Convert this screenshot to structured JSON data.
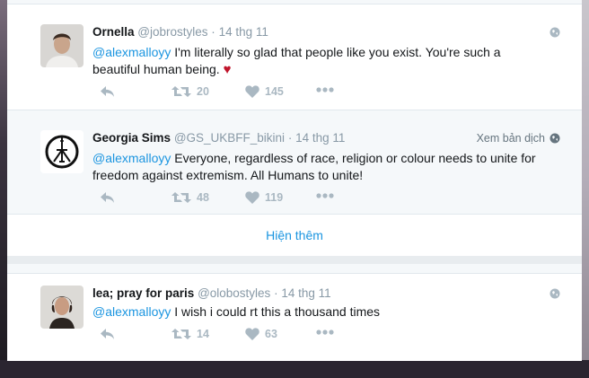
{
  "tweets": [
    {
      "name": "Ornella",
      "handle": "@jobrostyles",
      "sep": "·",
      "time": "14 thg 11",
      "mention": "@alexmalloyy",
      "text": " I'm literally so glad that people like you exist. You're such a beautiful human being. ",
      "emoji": "♥",
      "translate": "",
      "retweets": "20",
      "likes": "145"
    },
    {
      "name": "Georgia Sims",
      "handle": "@GS_UKBFF_bikini",
      "sep": "·",
      "time": "14 thg 11",
      "mention": "@alexmalloyy",
      "text": " Everyone, regardless of race, religion or colour needs to unite for freedom against extremism. All Humans to unite!",
      "translate": "Xem bản dịch",
      "retweets": "48",
      "likes": "119"
    },
    {
      "name": "lea; pray for paris",
      "handle": "@olobostyles",
      "sep": "·",
      "time": "14 thg 11",
      "mention": "@alexmalloyy",
      "text": " I wish i could rt this a thousand times",
      "translate": "",
      "retweets": "14",
      "likes": "63"
    }
  ],
  "show_more": "Hiện thêm",
  "icons": {
    "reply": "reply-icon",
    "retweet": "retweet-icon",
    "like": "heart-icon",
    "more": "more-icon",
    "globe": "globe-icon"
  },
  "colors": {
    "link": "#1b95e0",
    "muted": "#8899a6",
    "action": "#aab8c2",
    "heart": "#c0142b"
  }
}
